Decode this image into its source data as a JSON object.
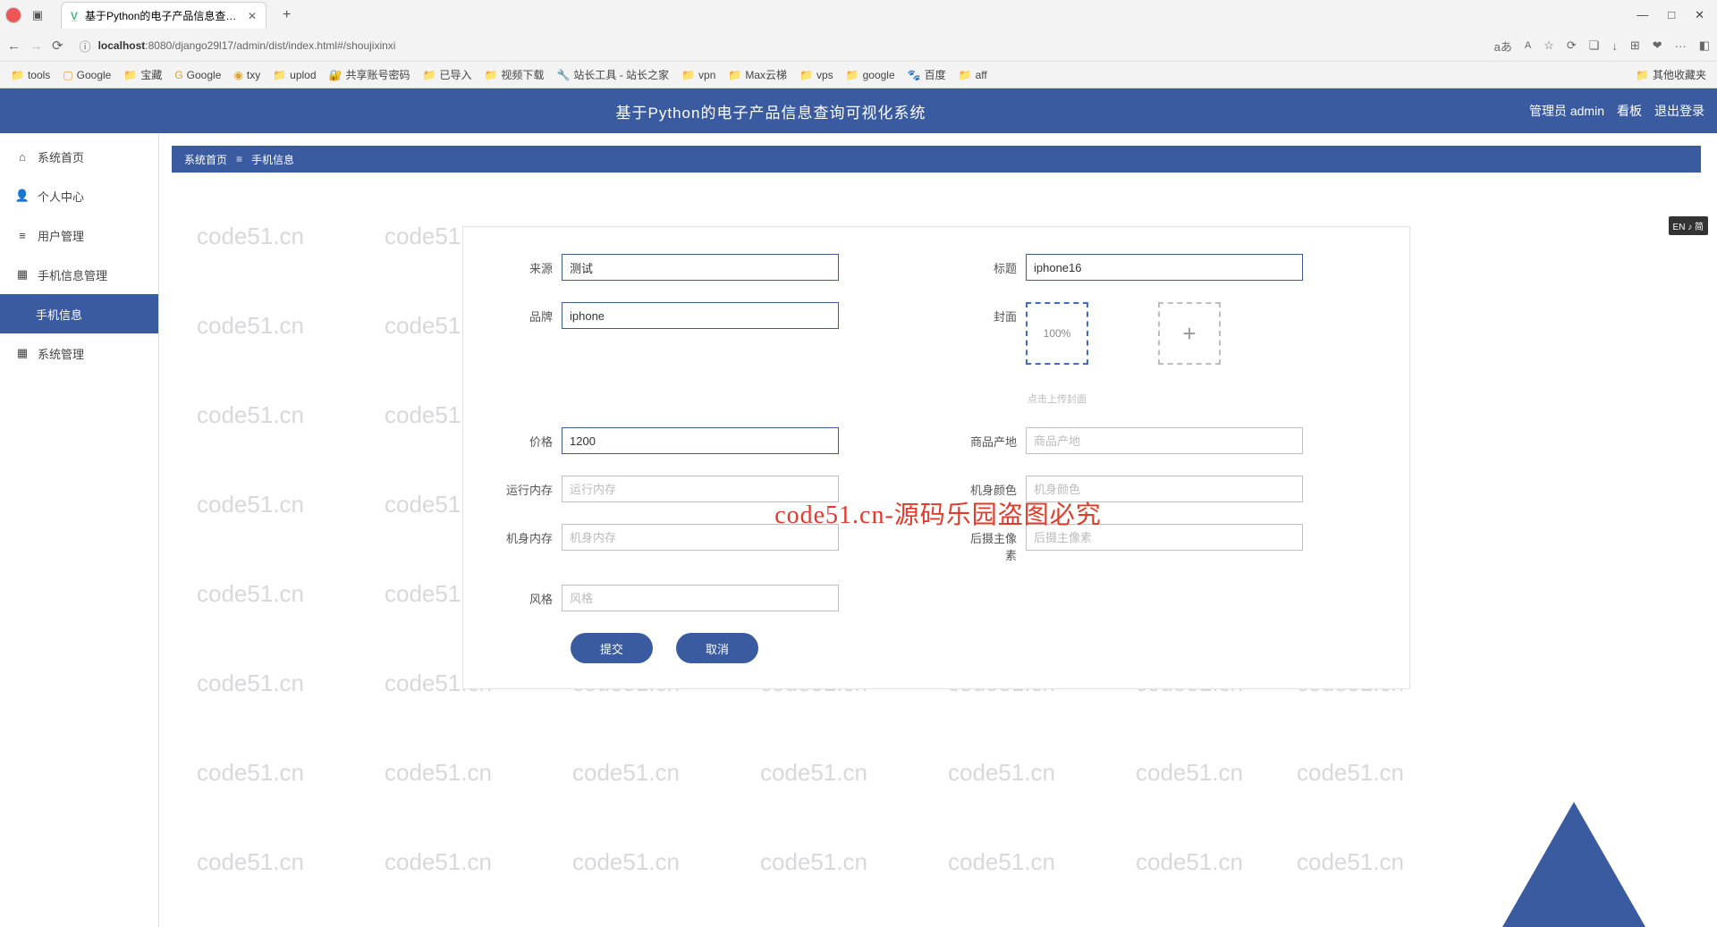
{
  "browser": {
    "tab_title": "基于Python的电子产品信息查询可",
    "url_prefix": "localhost",
    "url_rest": ":8080/django29l17/admin/dist/index.html#/shoujixinxi",
    "new_tab_symbol": "+",
    "win_min": "—",
    "win_max": "□",
    "win_close": "✕",
    "addr_icons": {
      "aa": "aあ",
      "AA": "A",
      "star": "☆",
      "ext1": "⟳",
      "ext2": "❏",
      "ext3": "↓",
      "ext4": "⊞",
      "ext5": "❤",
      "more": "···",
      "panel": "◧"
    },
    "nav": {
      "back": "←",
      "forward": "→",
      "refresh": "⟳",
      "info": "ⓘ"
    },
    "favorites": [
      {
        "icon": "📁",
        "label": "tools"
      },
      {
        "icon": "▢",
        "label": "Google"
      },
      {
        "icon": "📁",
        "label": "宝藏"
      },
      {
        "icon": "G",
        "label": "Google"
      },
      {
        "icon": "◉",
        "label": "txy"
      },
      {
        "icon": "📁",
        "label": "uplod"
      },
      {
        "icon": "🔐",
        "label": "共享账号密码"
      },
      {
        "icon": "📁",
        "label": "已导入"
      },
      {
        "icon": "📁",
        "label": "视频下载"
      },
      {
        "icon": "🔧",
        "label": "站长工具 - 站长之家"
      },
      {
        "icon": "📁",
        "label": "vpn"
      },
      {
        "icon": "📁",
        "label": "Max云梯"
      },
      {
        "icon": "📁",
        "label": "vps"
      },
      {
        "icon": "📁",
        "label": "google"
      },
      {
        "icon": "🐾",
        "label": "百度"
      },
      {
        "icon": "📁",
        "label": "aff"
      }
    ],
    "fav_right": "其他收藏夹"
  },
  "header": {
    "title": "基于Python的电子产品信息查询可视化系统",
    "admin_label": "管理员 admin",
    "dashboard": "看板",
    "logout": "退出登录"
  },
  "sidebar": {
    "items": [
      {
        "icon": "⌂",
        "label": "系统首页"
      },
      {
        "icon": "👤",
        "label": "个人中心"
      },
      {
        "icon": "≡",
        "label": "用户管理"
      },
      {
        "icon": "▦",
        "label": "手机信息管理"
      },
      {
        "icon": "",
        "label": "手机信息",
        "active": true,
        "sub": true
      },
      {
        "icon": "▦",
        "label": "系统管理"
      }
    ]
  },
  "breadcrumb": {
    "home": "系统首页",
    "sep": "≡",
    "current": "手机信息"
  },
  "form": {
    "source": {
      "label": "来源",
      "value": "测试"
    },
    "title": {
      "label": "标题",
      "value": "iphone16"
    },
    "brand": {
      "label": "品牌",
      "value": "iphone"
    },
    "cover": {
      "label": "封面",
      "progress": "100%",
      "add_symbol": "+",
      "hint": "点击上传封面"
    },
    "price": {
      "label": "价格",
      "value": "1200"
    },
    "origin": {
      "label": "商品产地",
      "placeholder": "商品产地"
    },
    "ram": {
      "label": "运行内存",
      "placeholder": "运行内存"
    },
    "color": {
      "label": "机身颜色",
      "placeholder": "机身颜色"
    },
    "rom": {
      "label": "机身内存",
      "placeholder": "机身内存"
    },
    "camera": {
      "label": "后摄主像素",
      "placeholder": "后摄主像素"
    },
    "style": {
      "label": "风格",
      "placeholder": "风格"
    },
    "submit": "提交",
    "cancel": "取消"
  },
  "watermark": {
    "text": "code51.cn",
    "center_text": "code51.cn-源码乐园盗图必究"
  },
  "ime": "EN ♪ 简"
}
